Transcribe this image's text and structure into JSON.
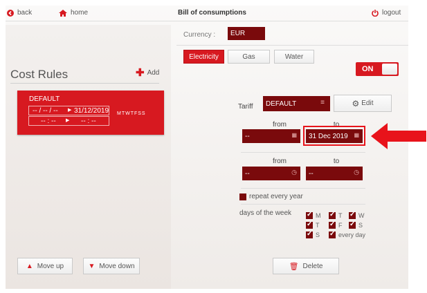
{
  "nav": {
    "back_label": "back",
    "home_label": "home",
    "title": "Bill of consumptions",
    "logout_label": "logout"
  },
  "currency": {
    "label": "Currency :",
    "value": "EUR"
  },
  "tabs": [
    {
      "label": "Electricity",
      "active": true
    },
    {
      "label": "Gas",
      "active": false
    },
    {
      "label": "Water",
      "active": false
    }
  ],
  "toggle": {
    "label": "ON"
  },
  "cost_rules": {
    "title": "Cost Rules",
    "add_label": "Add",
    "rule": {
      "name": "DEFAULT",
      "date_from": "-- / -- / --",
      "date_to": "31/12/2019",
      "time_from": "-- : --",
      "time_to": "-- : --",
      "days": "MTWTFSS"
    }
  },
  "tariff": {
    "label": "Tariff",
    "value": "DEFAULT",
    "edit_label": "Edit"
  },
  "date_range": {
    "from_label": "from",
    "to_label": "to",
    "from_value": "--",
    "to_value": "31 Dec 2019"
  },
  "time_range": {
    "from_label": "from",
    "to_label": "to",
    "from_value": "--",
    "to_value": "--"
  },
  "repeat": {
    "label": "repeat every year",
    "checked": false
  },
  "days_of_week": {
    "label": "days of the week",
    "days": [
      {
        "label": "M",
        "checked": true
      },
      {
        "label": "T",
        "checked": true
      },
      {
        "label": "W",
        "checked": true
      },
      {
        "label": "T",
        "checked": true
      },
      {
        "label": "F",
        "checked": true
      },
      {
        "label": "S",
        "checked": true
      },
      {
        "label": "S",
        "checked": true
      },
      {
        "label": "every day",
        "checked": true
      }
    ]
  },
  "buttons": {
    "move_up": "Move up",
    "move_down": "Move down",
    "delete": "Delete"
  },
  "colors": {
    "accent": "#d71920",
    "dark_field": "#7a0a0c",
    "highlight_arrow": "#e8131b"
  }
}
